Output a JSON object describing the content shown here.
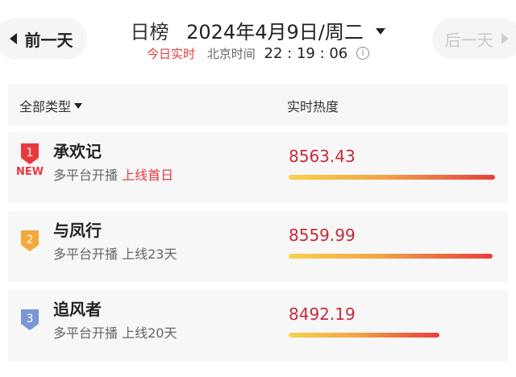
{
  "header": {
    "prev_label": "前一天",
    "next_label": "后一天",
    "board_label": "日榜",
    "date_text": "2024年4月9日/周二",
    "realtime_label": "今日实时",
    "beijing_label": "北京时间",
    "clock": "22 : 19 : 06",
    "info_symbol": "i"
  },
  "columns": {
    "type_label": "全部类型",
    "heat_label": "实时热度"
  },
  "rows": [
    {
      "rank": "1",
      "rank_color": "#e8393f",
      "new_tag": "NEW",
      "title": "承欢记",
      "platform": "多平台开播",
      "status": "上线首日",
      "heat": "8563.43",
      "heat_value": 8563.43
    },
    {
      "rank": "2",
      "rank_color": "#f4a93a",
      "title": "与凤行",
      "platform": "多平台开播",
      "status": "上线23天",
      "heat": "8559.99",
      "heat_value": 8559.99
    },
    {
      "rank": "3",
      "rank_color": "#7b96d4",
      "title": "追风者",
      "platform": "多平台开播",
      "status": "上线20天",
      "heat": "8492.19",
      "heat_value": 8492.19
    }
  ]
}
